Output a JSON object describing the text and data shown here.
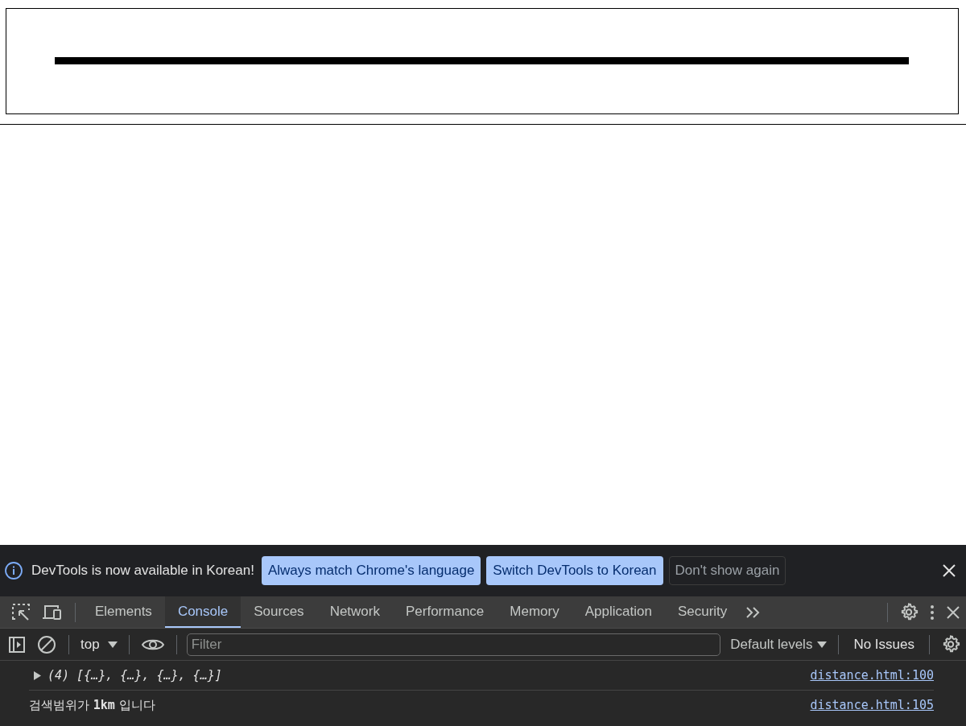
{
  "infobar": {
    "message": "DevTools is now available in Korean!",
    "buttons": [
      {
        "label": "Always match Chrome's language",
        "kind": "primary"
      },
      {
        "label": "Switch DevTools to Korean",
        "kind": "primary"
      },
      {
        "label": "Don't show again",
        "kind": "secondary"
      }
    ]
  },
  "tabs": [
    {
      "label": "Elements",
      "selected": false
    },
    {
      "label": "Console",
      "selected": true
    },
    {
      "label": "Sources",
      "selected": false
    },
    {
      "label": "Network",
      "selected": false
    },
    {
      "label": "Performance",
      "selected": false
    },
    {
      "label": "Memory",
      "selected": false
    },
    {
      "label": "Application",
      "selected": false
    },
    {
      "label": "Security",
      "selected": false
    }
  ],
  "console_toolbar": {
    "context": "top",
    "filter": {
      "placeholder": "Filter"
    },
    "levels": "Default levels",
    "issues": "No Issues"
  },
  "messages": [
    {
      "kind": "object",
      "text": "(4) [{…}, {…}, {…}, {…}]",
      "source": "distance.html:100"
    },
    {
      "kind": "log",
      "text": "검색범위가 **1km** 입니다",
      "source": "distance.html:105"
    }
  ]
}
